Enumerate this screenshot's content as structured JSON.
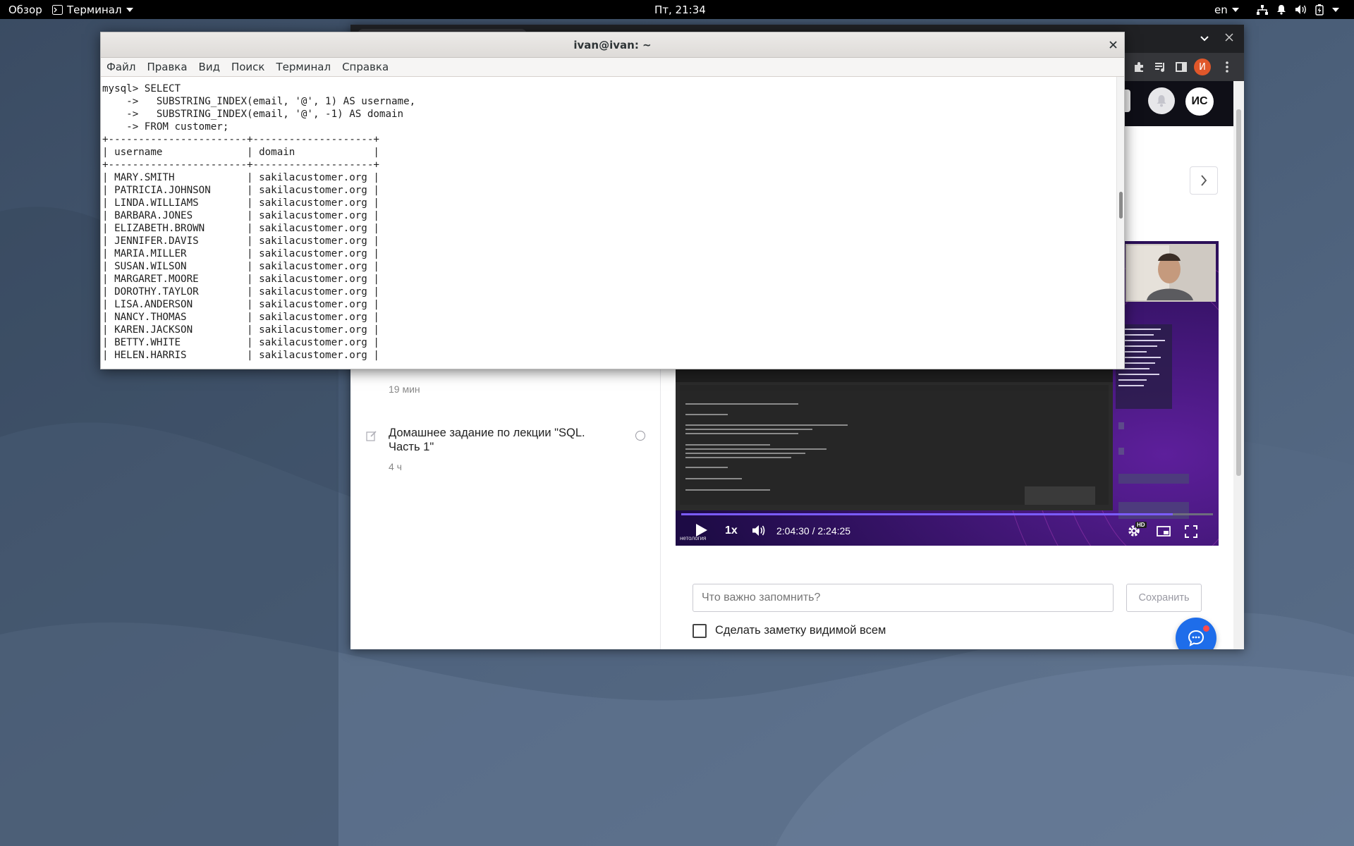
{
  "topbar": {
    "activities": "Обзор",
    "app_name": "Терминал",
    "clock": "Пт, 21:34",
    "lang": "en"
  },
  "browser": {
    "avatar_small": "И",
    "avatar_initials": "ИС",
    "lessons": [
      {
        "time": "19 мин"
      },
      {
        "title_line1": "Домашнее задание по лекции \"SQL.",
        "title_line2": "Часть 1\"",
        "time": "4 ч"
      }
    ],
    "video": {
      "speed": "1x",
      "time": "2:04:30 / 2:24:25",
      "hd": "HD",
      "watermark": "нетология"
    },
    "note": {
      "placeholder": "Что важно запомнить?",
      "save_label": "Сохранить",
      "checkbox_label": "Сделать заметку видимой всем"
    }
  },
  "terminal": {
    "title": "ivan@ivan: ~",
    "menu": [
      "Файл",
      "Правка",
      "Вид",
      "Поиск",
      "Терминал",
      "Справка"
    ],
    "lines": [
      "mysql> SELECT",
      "    ->   SUBSTRING_INDEX(email, '@', 1) AS username,",
      "    ->   SUBSTRING_INDEX(email, '@', -1) AS domain",
      "    -> FROM customer;",
      "+-----------------------+--------------------+",
      "| username              | domain             |",
      "+-----------------------+--------------------+",
      "| MARY.SMITH            | sakilacustomer.org |",
      "| PATRICIA.JOHNSON      | sakilacustomer.org |",
      "| LINDA.WILLIAMS        | sakilacustomer.org |",
      "| BARBARA.JONES         | sakilacustomer.org |",
      "| ELIZABETH.BROWN       | sakilacustomer.org |",
      "| JENNIFER.DAVIS        | sakilacustomer.org |",
      "| MARIA.MILLER          | sakilacustomer.org |",
      "| SUSAN.WILSON          | sakilacustomer.org |",
      "| MARGARET.MOORE        | sakilacustomer.org |",
      "| DOROTHY.TAYLOR        | sakilacustomer.org |",
      "| LISA.ANDERSON         | sakilacustomer.org |",
      "| NANCY.THOMAS          | sakilacustomer.org |",
      "| KAREN.JACKSON         | sakilacustomer.org |",
      "| BETTY.WHITE           | sakilacustomer.org |",
      "| HELEN.HARRIS          | sakilacustomer.org |"
    ]
  }
}
